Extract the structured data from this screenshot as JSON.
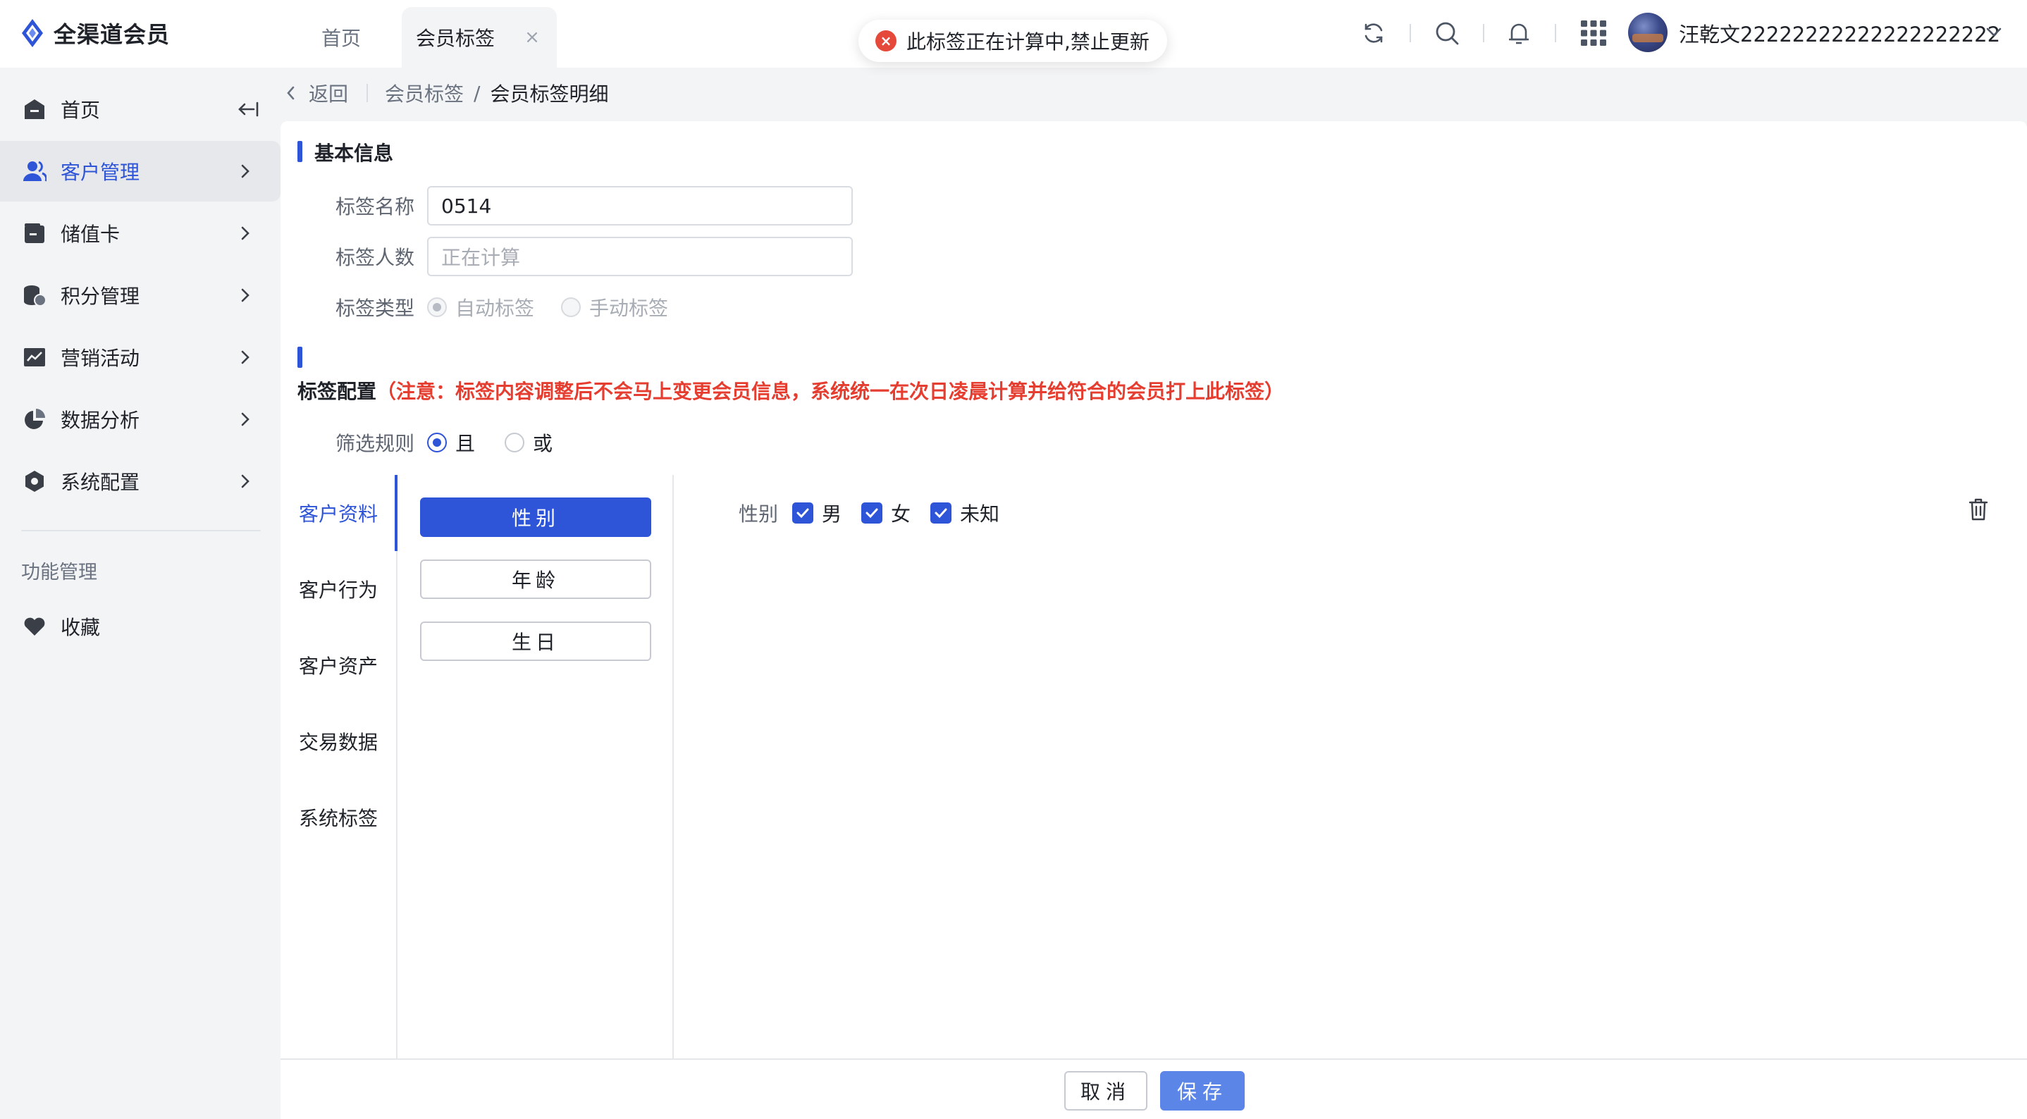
{
  "app": {
    "name": "全渠道会员",
    "brand_color": "#2e54d7"
  },
  "tabs": [
    {
      "label": "首页"
    },
    {
      "label": "会员标签",
      "active": true
    }
  ],
  "toast": {
    "message": "此标签正在计算中,禁止更新",
    "icon": "error-icon",
    "color": "#e5493a"
  },
  "header": {
    "icons": [
      "refresh-icon",
      "search-icon",
      "bell-icon",
      "apps-grid-icon"
    ],
    "user": {
      "name": "汪乾文22222222222222222222"
    }
  },
  "sidebar": {
    "items": [
      {
        "label": "首页",
        "icon": "home-icon"
      },
      {
        "label": "客户管理",
        "icon": "users-icon",
        "active": true
      },
      {
        "label": "储值卡",
        "icon": "wallet-icon"
      },
      {
        "label": "积分管理",
        "icon": "coins-icon"
      },
      {
        "label": "营销活动",
        "icon": "trend-chart-icon"
      },
      {
        "label": "数据分析",
        "icon": "pie-chart-icon"
      },
      {
        "label": "系统配置",
        "icon": "hexagon-settings-icon"
      }
    ],
    "section_title": "功能管理",
    "extra_items": [
      {
        "label": "收藏",
        "icon": "heart-icon"
      }
    ]
  },
  "breadcrumb": {
    "back_label": "返回",
    "items": [
      "会员标签",
      "会员标签明细"
    ],
    "separator": "/"
  },
  "basic_info": {
    "title": "基本信息",
    "fields": {
      "tag_name": {
        "label": "标签名称",
        "value": "0514"
      },
      "tag_count": {
        "label": "标签人数",
        "placeholder": "正在计算"
      },
      "tag_type": {
        "label": "标签类型",
        "options": [
          "自动标签",
          "手动标签"
        ],
        "selected": "自动标签"
      }
    }
  },
  "tag_config": {
    "title": "标签配置",
    "notice": "（注意：标签内容调整后不会马上变更会员信息，系统统一在次日凌晨计算并给符合的会员打上此标签）",
    "filter_rule": {
      "label": "筛选规则",
      "options": [
        "且",
        "或"
      ],
      "selected": "且"
    },
    "categories": [
      "客户资料",
      "客户行为",
      "客户资产",
      "交易数据",
      "系统标签"
    ],
    "active_category": "客户资料",
    "fields": [
      "性别",
      "年龄",
      "生日"
    ],
    "active_field": "性别",
    "rule": {
      "label": "性别",
      "options": [
        {
          "label": "男",
          "checked": true
        },
        {
          "label": "女",
          "checked": true
        },
        {
          "label": "未知",
          "checked": true
        }
      ]
    }
  },
  "footer": {
    "cancel_label": "取消",
    "save_label": "保存"
  }
}
